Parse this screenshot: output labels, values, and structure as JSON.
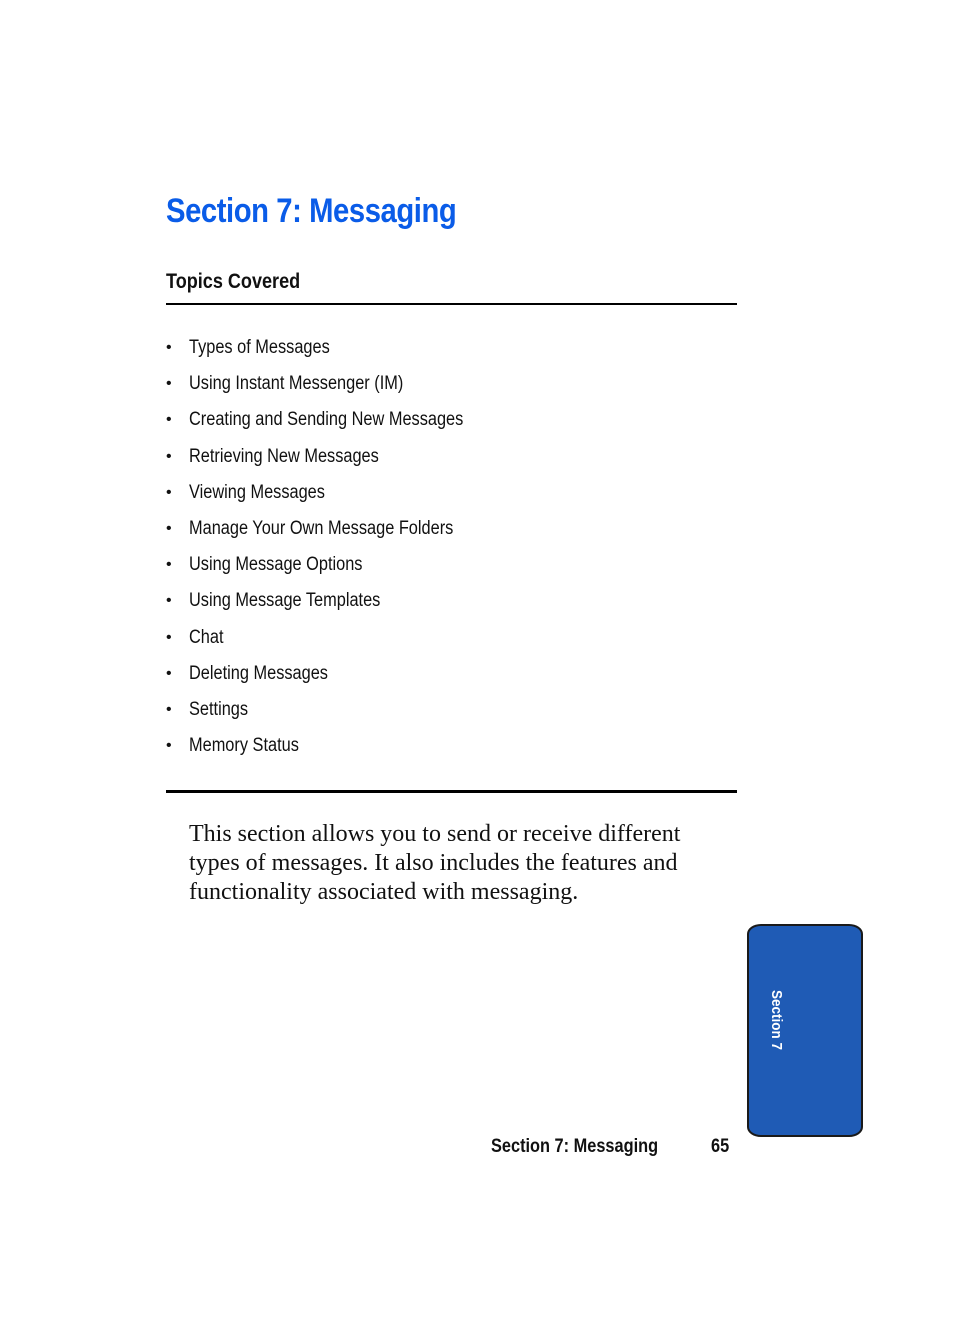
{
  "page": {
    "title": "Section 7: Messaging",
    "title_color": "#0a5ce8",
    "topics_heading": "Topics Covered",
    "bullet_glyph": "•",
    "topics": [
      "Types of Messages",
      "Using Instant Messenger (IM)",
      "Creating and Sending New Messages",
      "Retrieving New Messages",
      "Viewing Messages",
      "Manage Your Own Message Folders",
      "Using Message Options",
      "Using Message Templates",
      "Chat",
      "Deleting Messages",
      "Settings",
      "Memory Status"
    ],
    "intro": "This section allows you to send or receive different types of messages. It also includes the features and functionality associated with messaging.",
    "side_tab": {
      "label": "Section 7",
      "color": "#1f5bb5"
    },
    "footer": {
      "section": "Section 7: Messaging",
      "page_number": "65"
    }
  }
}
